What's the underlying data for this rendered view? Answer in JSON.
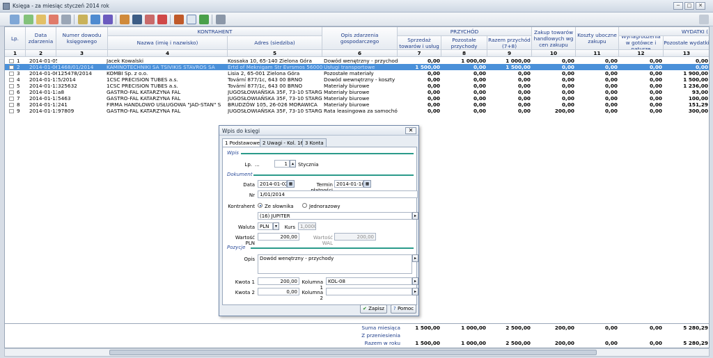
{
  "window": {
    "title": "Księga - za miesiąc styczeń 2014 rok",
    "min": "─",
    "max": "□",
    "close": "✕"
  },
  "header": {
    "lp": "Lp.",
    "data": "Data zdarzenia",
    "dowod": "Numer dowodu księgowego",
    "kontrahent": "KONTRAHENT",
    "nazwa": "Nazwa (imię i nazwisko)",
    "adres": "Adres (siedziba)",
    "opis": "Opis zdarzenia gospodarczego",
    "przychod": "PRZYCHÓD",
    "sprzedaz": "Sprzedaż towarów i usług",
    "pozostale": "Pozostałe przychody",
    "razem": "Razem przychód (7+8)",
    "zakup": "Zakup towarów handlowych wg cen zakupu",
    "koszty": "Koszty uboczne zakupu",
    "wynagrodzenia": "Wynagrodzenia w gotówce i naturze",
    "pozwydatki": "Pozostałe wydatki",
    "wydatki": "WYDATKI (",
    "numbers": [
      "1",
      "2",
      "3",
      "4",
      "5",
      "6",
      "7",
      "8",
      "9",
      "10",
      "11",
      "12",
      "13"
    ]
  },
  "rows": [
    {
      "lp": "1",
      "data": "2014-01-05",
      "dowod": "",
      "nazwa": "Jacek Kowalski",
      "adres": "Kossaka 10, 65-140 Zielona Góra",
      "opis": "Dowód wenętrzny - przychody",
      "c7": "0,00",
      "c8": "1 000,00",
      "c9": "1 000,00",
      "c10": "0,00",
      "c11": "0,00",
      "c12": "0,00",
      "c13": "0,00"
    },
    {
      "lp": "2",
      "data": "2014-01-06",
      "dowod": "1468/01/2014",
      "nazwa": "KAMINOTECHNIKI SA TSIVIKIS STAVROS SA",
      "adres": "Ertd of Meknigam Str Evrsmos 56000 TH",
      "opis": "Usługi transportowe",
      "c7": "1 500,00",
      "c8": "0,00",
      "c9": "1 500,00",
      "c10": "0,00",
      "c11": "0,00",
      "c12": "0,00",
      "c13": "0,00"
    },
    {
      "lp": "3",
      "data": "2014-01-06",
      "dowod": "125478/2014",
      "nazwa": "KOMBI Sp. z o.o.",
      "adres": "Lisia 2, 65-001 Zielona Góra",
      "opis": "Pozostałe materiały",
      "c7": "0,00",
      "c8": "0,00",
      "c9": "0,00",
      "c10": "0,00",
      "c11": "0,00",
      "c12": "0,00",
      "c13": "1 900,00"
    },
    {
      "lp": "4",
      "data": "2014-01-11",
      "dowod": "5/2014",
      "nazwa": "1CSC PRECISION TUBES a.s.",
      "adres": "Tovární 877/1c, 643 00 BRNO",
      "opis": "Dowód wewnętrzny - koszty",
      "c7": "0,00",
      "c8": "0,00",
      "c9": "0,00",
      "c10": "0,00",
      "c11": "0,00",
      "c12": "0,00",
      "c13": "1 500,00"
    },
    {
      "lp": "5",
      "data": "2014-01-13",
      "dowod": "325632",
      "nazwa": "1CSC PRECISION TUBES a.s.",
      "adres": "Tovární 877/1c, 643 00 BRNO",
      "opis": "Materiały biurowe",
      "c7": "0,00",
      "c8": "0,00",
      "c9": "0,00",
      "c10": "0,00",
      "c11": "0,00",
      "c12": "0,00",
      "c13": "1 236,00"
    },
    {
      "lp": "6",
      "data": "2014-01-13",
      "dowod": "a8",
      "nazwa": "GASTRO-FAL KATARZYNA FAL",
      "adres": "JUGOSŁOWIAŃSKA 35F, 73-10 STARGA",
      "opis": "Materiały biurowe",
      "c7": "0,00",
      "c8": "0,00",
      "c9": "0,00",
      "c10": "0,00",
      "c11": "0,00",
      "c12": "0,00",
      "c13": "93,00"
    },
    {
      "lp": "7",
      "data": "2014-01-13",
      "dowod": "5463",
      "nazwa": "GASTRO-FAL KATARZYNA FAL",
      "adres": "JUGOSŁOWIAŃSKA 35F, 73-10 STARGA",
      "opis": "Materiały biurowe",
      "c7": "0,00",
      "c8": "0,00",
      "c9": "0,00",
      "c10": "0,00",
      "c11": "0,00",
      "c12": "0,00",
      "c13": "100,00"
    },
    {
      "lp": "8",
      "data": "2014-01-13",
      "dowod": "241",
      "nazwa": "FIRMA HANDLOWO USŁUGOWA \"JAD-STAN\" S",
      "adres": "BRUDZÓW 105, 26-026 MORAWICA",
      "opis": "Materiały biurowe",
      "c7": "0,00",
      "c8": "0,00",
      "c9": "0,00",
      "c10": "0,00",
      "c11": "0,00",
      "c12": "0,00",
      "c13": "151,29"
    },
    {
      "lp": "9",
      "data": "2014-01-13",
      "dowod": "97809",
      "nazwa": "GASTRO-FAL KATARZYNA FAL",
      "adres": "JUGOSŁOWIAŃSKA 35F, 73-10 STARGA",
      "opis": "Rata leasingowa za samochód",
      "c7": "0,00",
      "c8": "0,00",
      "c9": "0,00",
      "c10": "200,00",
      "c11": "0,00",
      "c12": "0,00",
      "c13": "300,00"
    }
  ],
  "footer": {
    "suma": {
      "label": "Suma miesiąca",
      "c7": "1 500,00",
      "c8": "1 000,00",
      "c9": "2 500,00",
      "c10": "200,00",
      "c11": "0,00",
      "c12": "0,00",
      "c13": "5 280,29"
    },
    "przeniesienie": {
      "label": "Z przeniesienia",
      "c7": "",
      "c8": "",
      "c9": "",
      "c10": "",
      "c11": "",
      "c12": "",
      "c13": ""
    },
    "razem": {
      "label": "Razem w roku",
      "c7": "1 500,00",
      "c8": "1 000,00",
      "c9": "2 500,00",
      "c10": "200,00",
      "c11": "0,00",
      "c12": "0,00",
      "c13": "5 280,29"
    }
  },
  "dialog": {
    "title": "Wpis do księgi",
    "close": "✕",
    "tabs": [
      "1 Podstawowe",
      "2 Uwagi - Kol. 16",
      "3 Konta"
    ],
    "wpis": "Wpis",
    "lp_label": "Lp.",
    "lp_dots": "...",
    "lp_value": "1",
    "lp_month": "Stycznia",
    "dokument": "Dokument",
    "data_label": "Data",
    "data_value": "2014-01-02",
    "termin_label": "Termin płatności",
    "termin_value": "2014-01-16",
    "nr_label": "Nr",
    "nr_value": "1/01/2014",
    "kontrahent_label": "Kontrahent",
    "radio_slownik": "Ze słownika",
    "radio_jednorazowy": "Jednorazowy",
    "kontrahent_value": "(16) JUPITER",
    "waluta_label": "Waluta",
    "waluta_value": "PLN",
    "kurs_label": "Kurs",
    "kurs_value": "1,0000",
    "wartosc_pln_label": "Wartość PLN",
    "wartosc_pln": "200,00",
    "wartosc_wal_label": "Wartość WAL",
    "wartosc_wal": "200,00",
    "pozycje": "Pozycje",
    "opis_label": "Opis",
    "opis_value": "Dowód wenętrzny - przychody",
    "kwota1_label": "Kwota 1",
    "kwota1": "200,00",
    "kolumna1_label": "Kolumna 1",
    "kolumna1": "KOL-08",
    "kwota2_label": "Kwota 2",
    "kwota2": "0,00",
    "kolumna2_label": "Kolumna 2",
    "kolumna2": "",
    "zapisz": "Zapisz",
    "pomoc": "Pomoc"
  }
}
